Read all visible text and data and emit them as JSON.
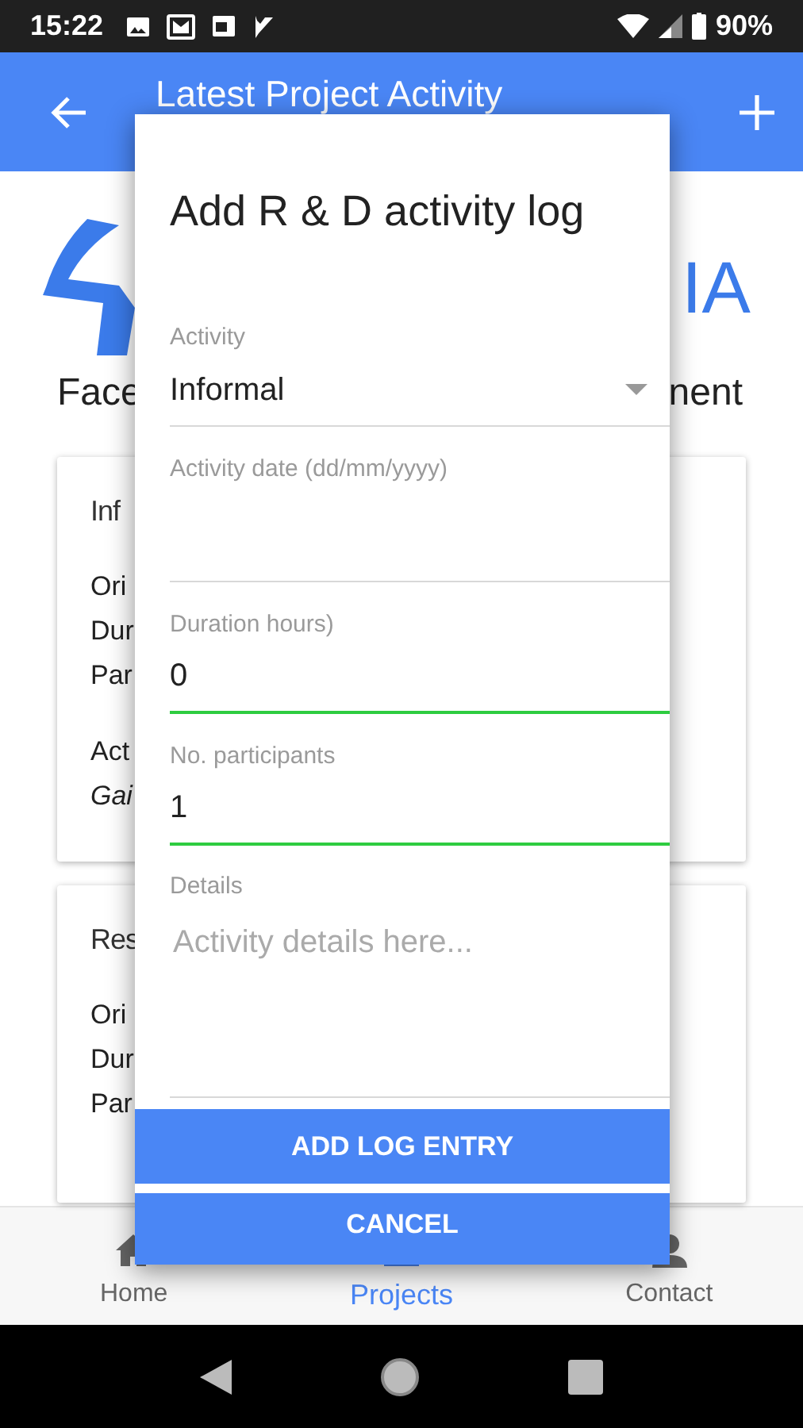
{
  "status_bar": {
    "time": "15:22",
    "battery": "90%"
  },
  "app_bar": {
    "title": "Latest Project Activity"
  },
  "background": {
    "logo_text": "IA",
    "heading_left": "Face",
    "heading_right": "nent",
    "cards": [
      {
        "title": "Inf",
        "groups": [
          [
            {
              "text": "Ori",
              "italic": false
            },
            {
              "text": "Dur",
              "italic": false
            },
            {
              "text": "Par",
              "italic": false
            }
          ],
          [
            {
              "text": "Act",
              "italic": false
            },
            {
              "text": "Gai",
              "italic": true
            }
          ]
        ]
      },
      {
        "title": "Res",
        "groups": [
          [
            {
              "text": "Ori",
              "italic": false
            },
            {
              "text": "Dur",
              "italic": false
            },
            {
              "text": "Par",
              "italic": false
            }
          ]
        ]
      }
    ]
  },
  "dialog": {
    "title": "Add R & D activity log",
    "fields": [
      {
        "kind": "select",
        "label": "Activity",
        "value": "Informal",
        "valid": false
      },
      {
        "kind": "text",
        "label": "Activity date (dd/mm/yyyy)",
        "valid": false
      },
      {
        "kind": "text",
        "label": "Duration hours)",
        "value": "0",
        "valid": true
      },
      {
        "kind": "text",
        "label": "No. participants",
        "value": "1",
        "valid": true
      },
      {
        "kind": "textarea",
        "label": "Details",
        "placeholder": "Activity details here...",
        "valid": false
      }
    ],
    "buttons": [
      "ADD LOG ENTRY",
      "CANCEL"
    ]
  },
  "bottom_nav": [
    {
      "label": "Home",
      "selected": false
    },
    {
      "label": "Projects",
      "selected": true
    },
    {
      "label": "Contact",
      "selected": false
    }
  ]
}
